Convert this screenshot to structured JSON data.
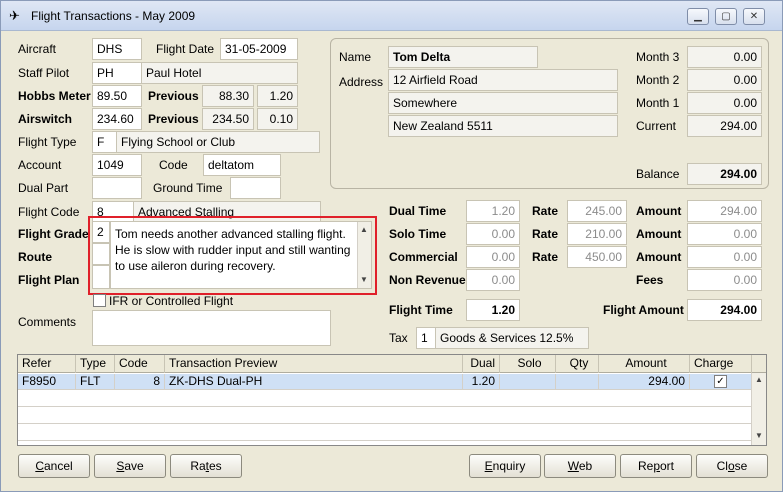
{
  "window": {
    "title": "Flight Transactions - May 2009"
  },
  "left": {
    "aircraft_label": "Aircraft",
    "aircraft": "DHS",
    "flight_date_label": "Flight Date",
    "flight_date": "31-05-2009",
    "staff_pilot_label": "Staff Pilot",
    "staff_pilot_code": "PH",
    "staff_pilot_name": "Paul Hotel",
    "hobbs_label": "Hobbs Meter",
    "hobbs": "89.50",
    "hobbs_prev_label": "Previous",
    "hobbs_prev": "88.30",
    "hobbs_diff": "1.20",
    "airswitch_label": "Airswitch",
    "airswitch": "234.60",
    "airswitch_prev_label": "Previous",
    "airswitch_prev": "234.50",
    "airswitch_diff": "0.10",
    "flight_type_label": "Flight Type",
    "flight_type_code": "F",
    "flight_type_name": "Flying School or Club",
    "account_label": "Account",
    "account": "1049",
    "code_label": "Code",
    "code": "deltatom",
    "dual_part_label": "Dual Part",
    "ground_time_label": "Ground Time",
    "flight_code_label": "Flight Code",
    "flight_code": "8",
    "flight_code_name": "Advanced Stalling",
    "flight_grade_label": "Flight Grade",
    "flight_grade": "2",
    "route_label": "Route",
    "flight_plan_label": "Flight Plan",
    "notes": "Tom needs another advanced stalling flight. He is slow with rudder input and still wanting to use aileron during recovery.",
    "ifr_label": "IFR or Controlled Flight",
    "comments_label": "Comments"
  },
  "account_box": {
    "name_label": "Name",
    "name": "Tom Delta",
    "address_label": "Address",
    "address1": "12 Airfield Road",
    "address2": "Somewhere",
    "address3": "New Zealand 5511",
    "month3_label": "Month 3",
    "month3": "0.00",
    "month2_label": "Month 2",
    "month2": "0.00",
    "month1_label": "Month 1",
    "month1": "0.00",
    "current_label": "Current",
    "current": "294.00",
    "balance_label": "Balance",
    "balance": "294.00"
  },
  "charges": {
    "dual_time_label": "Dual Time",
    "dual_time": "1.20",
    "dual_rate_label": "Rate",
    "dual_rate": "245.00",
    "dual_amount_label": "Amount",
    "dual_amount": "294.00",
    "solo_time_label": "Solo Time",
    "solo_time": "0.00",
    "solo_rate_label": "Rate",
    "solo_rate": "210.00",
    "solo_amount_label": "Amount",
    "solo_amount": "0.00",
    "commercial_label": "Commercial",
    "commercial": "0.00",
    "commercial_rate_label": "Rate",
    "commercial_rate": "450.00",
    "commercial_amount_label": "Amount",
    "commercial_amount": "0.00",
    "non_revenue_label": "Non Revenue",
    "non_revenue": "0.00",
    "fees_label": "Fees",
    "fees": "0.00",
    "flight_time_label": "Flight Time",
    "flight_time": "1.20",
    "flight_amount_label": "Flight Amount",
    "flight_amount": "294.00",
    "tax_label": "Tax",
    "tax_code": "1",
    "tax_name": "Goods & Services 12.5%"
  },
  "grid": {
    "columns": [
      "Refer",
      "Type",
      "Code",
      "Transaction Preview",
      "Dual",
      "Solo",
      "Qty",
      "Amount",
      "Charge"
    ],
    "rows": [
      {
        "refer": "F8950",
        "type": "FLT",
        "code": "8",
        "preview": "ZK-DHS Dual-PH",
        "dual": "1.20",
        "solo": "",
        "qty": "",
        "amount": "294.00",
        "charge": "✓"
      }
    ]
  },
  "buttons": {
    "cancel_u": "C",
    "cancel_rest": "ancel",
    "save_u": "S",
    "save_rest": "ave",
    "rates_pre": "Ra",
    "rates_u": "t",
    "rates_rest": "es",
    "enquiry_u": "E",
    "enquiry_rest": "nquiry",
    "web_u": "W",
    "web_rest": "eb",
    "report_pre": "Re",
    "report_u": "p",
    "report_rest": "ort",
    "close_pre": "Cl",
    "close_u": "o",
    "close_rest": "se"
  },
  "icons": {
    "app": "plane-icon",
    "minimize": "minimize-icon",
    "maximize": "maximize-icon",
    "close": "close-icon"
  }
}
